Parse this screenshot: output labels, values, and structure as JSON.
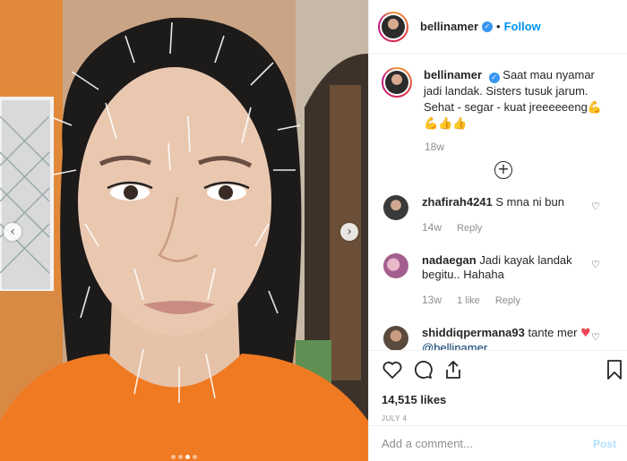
{
  "post": {
    "image_alt": "Selfie of a woman with acupuncture needles in her face and head",
    "carousel": {
      "slides": 4,
      "active_index": 2
    }
  },
  "header": {
    "username": "bellinamer",
    "verified": true,
    "separator": "•",
    "follow_label": "Follow"
  },
  "caption": {
    "username": "bellinamer",
    "text": "Saat mau nyamar jadi landak. Sisters tusuk jarum. Sehat - segar - kuat jreeeeeeng💪💪👍👍",
    "time": "18w"
  },
  "load_more_symbol": "+",
  "comments": [
    {
      "username": "zhafirah4241",
      "text": "S mna ni bun",
      "time": "14w",
      "likes": "",
      "reply_label": "Reply",
      "avatar_color": "#3a3a3a"
    },
    {
      "username": "nadaegan",
      "text": "Jadi kayak landak begitu.. Hahaha",
      "time": "13w",
      "likes": "1 like",
      "reply_label": "Reply",
      "avatar_color": "#c27fa8"
    },
    {
      "username": "shiddiqpermana93",
      "text": "tante mer",
      "heart": "♥",
      "mention": "@bellinamer",
      "time": "",
      "likes": "",
      "reply_label": "",
      "avatar_color": "#5a4a3e"
    }
  ],
  "actions": {
    "like_icon": "heart-outline-icon",
    "comment_icon": "comment-bubble-icon",
    "share_icon": "share-icon",
    "save_icon": "bookmark-icon",
    "likes_text": "14,515 likes",
    "date_text": "JULY 4"
  },
  "composer": {
    "placeholder": "Add a comment...",
    "post_label": "Post"
  },
  "colors": {
    "link_blue": "#0095f6",
    "verified_blue": "#3897f0",
    "muted": "#8e8e8e",
    "heart_red": "#ed4956"
  }
}
